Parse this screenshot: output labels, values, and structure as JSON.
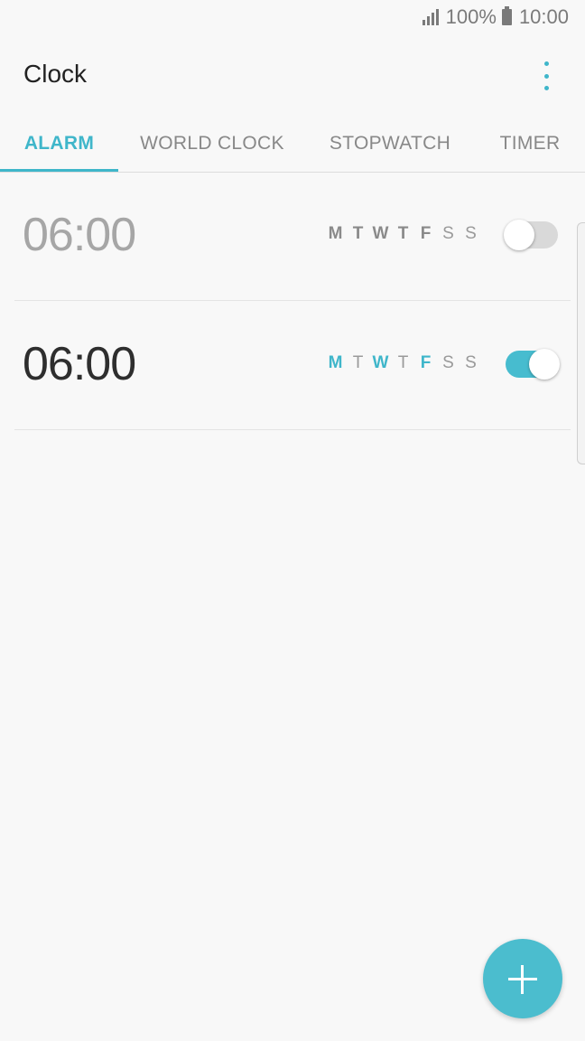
{
  "status_bar": {
    "battery": "100%",
    "time": "10:00"
  },
  "app": {
    "title": "Clock"
  },
  "tabs": [
    {
      "label": "ALARM",
      "active": true
    },
    {
      "label": "WORLD CLOCK",
      "active": false
    },
    {
      "label": "STOPWATCH",
      "active": false
    },
    {
      "label": "TIMER",
      "active": false
    }
  ],
  "alarms": [
    {
      "time": "06:00",
      "enabled": false,
      "days": [
        {
          "letter": "M",
          "selected": true
        },
        {
          "letter": "T",
          "selected": true
        },
        {
          "letter": "W",
          "selected": true
        },
        {
          "letter": "T",
          "selected": true
        },
        {
          "letter": "F",
          "selected": true
        },
        {
          "letter": "S",
          "selected": false
        },
        {
          "letter": "S",
          "selected": false
        }
      ]
    },
    {
      "time": "06:00",
      "enabled": true,
      "days": [
        {
          "letter": "M",
          "selected": true
        },
        {
          "letter": "T",
          "selected": false
        },
        {
          "letter": "W",
          "selected": true
        },
        {
          "letter": "T",
          "selected": false
        },
        {
          "letter": "F",
          "selected": true
        },
        {
          "letter": "S",
          "selected": false
        },
        {
          "letter": "S",
          "selected": false
        }
      ]
    }
  ],
  "colors": {
    "accent": "#3fb6ca",
    "background": "#f8f8f8"
  },
  "icons": {
    "more": "more-vert-icon",
    "add": "plus-icon"
  }
}
